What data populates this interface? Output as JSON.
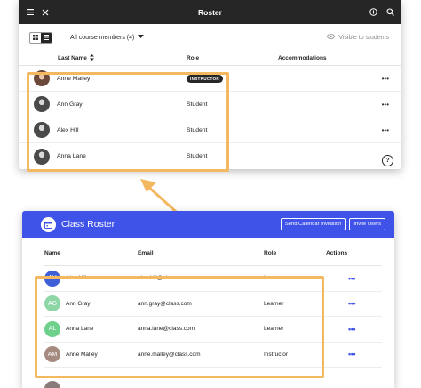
{
  "old_roster": {
    "title": "Roster",
    "filter_label": "All course members (4)",
    "visible_label": "Visible to students",
    "columns": {
      "name": "Last Name",
      "role": "Role",
      "accommodations": "Accommodations"
    },
    "rows": [
      {
        "name": "Anne Malley",
        "role": "INSTRUCTOR",
        "role_is_badge": true
      },
      {
        "name": "Ann Gray",
        "role": "Student"
      },
      {
        "name": "Alex Hill",
        "role": "Student"
      },
      {
        "name": "Anna Lane",
        "role": "Student"
      }
    ],
    "more_icon": "•••",
    "help_icon": "?"
  },
  "new_roster": {
    "title": "Class Roster",
    "buttons": {
      "calendar": "Send Calendar Invitation",
      "invite": "Invite Users"
    },
    "columns": {
      "name": "Name",
      "email": "Email",
      "role": "Role",
      "actions": "Actions"
    },
    "rows": [
      {
        "initials": "AH",
        "name": "Alex Hill",
        "email": "alex.hill@class.com",
        "role": "Learner",
        "color": "#3f5fd6"
      },
      {
        "initials": "AG",
        "name": "Ann Gray",
        "email": "ann.gray@class.com",
        "role": "Learner",
        "color": "#8fd6a6"
      },
      {
        "initials": "AL",
        "name": "Anna Lane",
        "email": "anna.lane@class.com",
        "role": "Learner",
        "color": "#6dd18c"
      },
      {
        "initials": "AM",
        "name": "Anne Malley",
        "email": "anne.malley@class.com",
        "role": "Instructor",
        "color": "#a58a80"
      }
    ],
    "actions_icon": "•••"
  },
  "colors": {
    "highlight": "#f4b860",
    "brand": "#4053e8",
    "dark_bar": "#262626"
  }
}
